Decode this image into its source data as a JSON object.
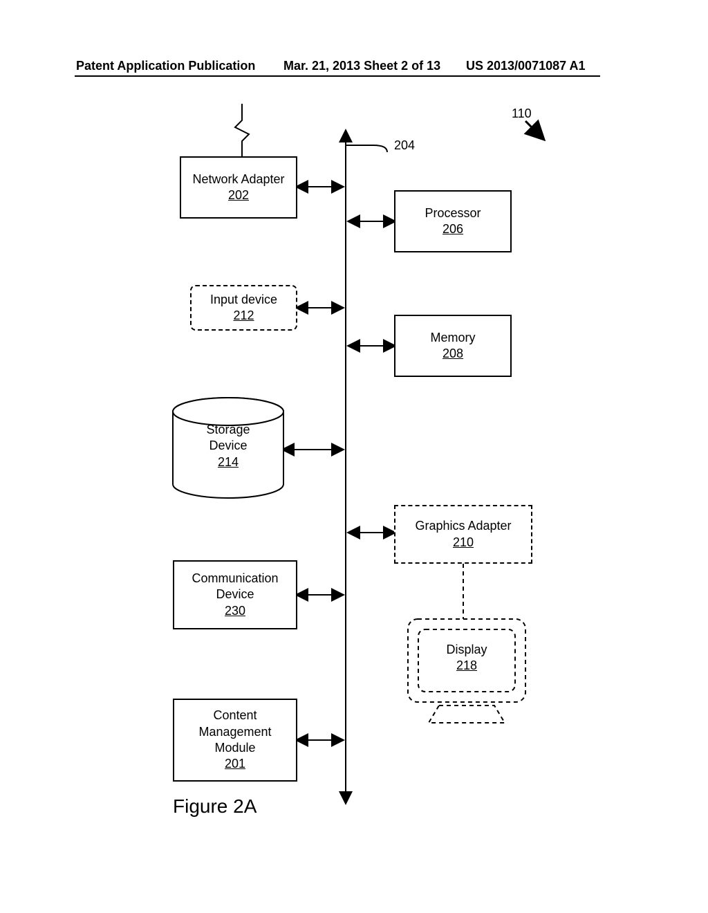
{
  "header": {
    "left": "Patent Application Publication",
    "mid": "Mar. 21, 2013  Sheet 2 of 13",
    "right": "US 2013/0071087 A1"
  },
  "labels": {
    "bus": "204",
    "system": "110"
  },
  "blocks": {
    "network_adapter": {
      "title": "Network Adapter",
      "ref": "202"
    },
    "processor": {
      "title": "Processor",
      "ref": "206"
    },
    "input_device": {
      "title": "Input device",
      "ref": "212"
    },
    "memory": {
      "title": "Memory",
      "ref": "208"
    },
    "storage": {
      "title": "Storage Device",
      "ref": "214"
    },
    "graphics": {
      "title": "Graphics Adapter",
      "ref": "210"
    },
    "comm_device": {
      "title": "Communication Device",
      "ref": "230"
    },
    "display": {
      "title": "Display",
      "ref": "218"
    },
    "content_mgmt": {
      "title": "Content Management Module",
      "ref": "201"
    }
  },
  "figure_caption": "Figure 2A"
}
